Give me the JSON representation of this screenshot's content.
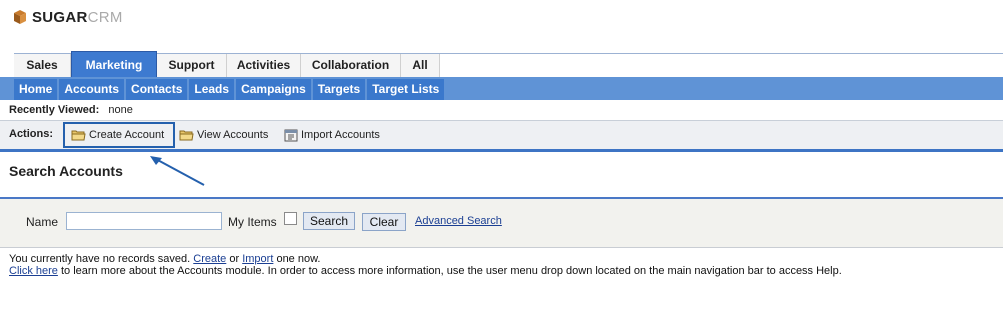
{
  "logo": {
    "part1": "SUGAR",
    "part2": "CRM"
  },
  "main_tabs": [
    {
      "label": "Sales"
    },
    {
      "label": "Marketing",
      "active": true
    },
    {
      "label": "Support"
    },
    {
      "label": "Activities"
    },
    {
      "label": "Collaboration"
    },
    {
      "label": "All"
    }
  ],
  "sub_tabs": [
    {
      "label": "Home"
    },
    {
      "label": "Accounts"
    },
    {
      "label": "Contacts"
    },
    {
      "label": "Leads"
    },
    {
      "label": "Campaigns"
    },
    {
      "label": "Targets"
    },
    {
      "label": "Target Lists"
    }
  ],
  "recent": {
    "label": "Recently Viewed:",
    "value": "none"
  },
  "actions": {
    "label": "Actions:",
    "items": [
      {
        "label": "Create Account",
        "icon": "folder-icon"
      },
      {
        "label": "View Accounts",
        "icon": "folder-icon"
      },
      {
        "label": "Import Accounts",
        "icon": "import-icon"
      }
    ]
  },
  "search": {
    "title": "Search Accounts",
    "name_label": "Name",
    "name_value": "",
    "my_items_label": "My Items",
    "search_button": "Search",
    "clear_button": "Clear",
    "advanced_link": "Advanced Search"
  },
  "info": {
    "line1_a": "You currently have no records saved. ",
    "create_link": "Create",
    "line1_b": " or ",
    "import_link": "Import",
    "line1_c": " one now.",
    "click_here": "Click here",
    "line2": " to learn more about the Accounts module. In order to access more information, use the user menu drop down located on the main navigation bar to access Help."
  },
  "colors": {
    "tab_active": "#3d7ad0",
    "sub_bar": "#5f93d6",
    "sub_tab": "#3a78cc",
    "highlight": "#2460ad",
    "link": "#1b3f93"
  }
}
